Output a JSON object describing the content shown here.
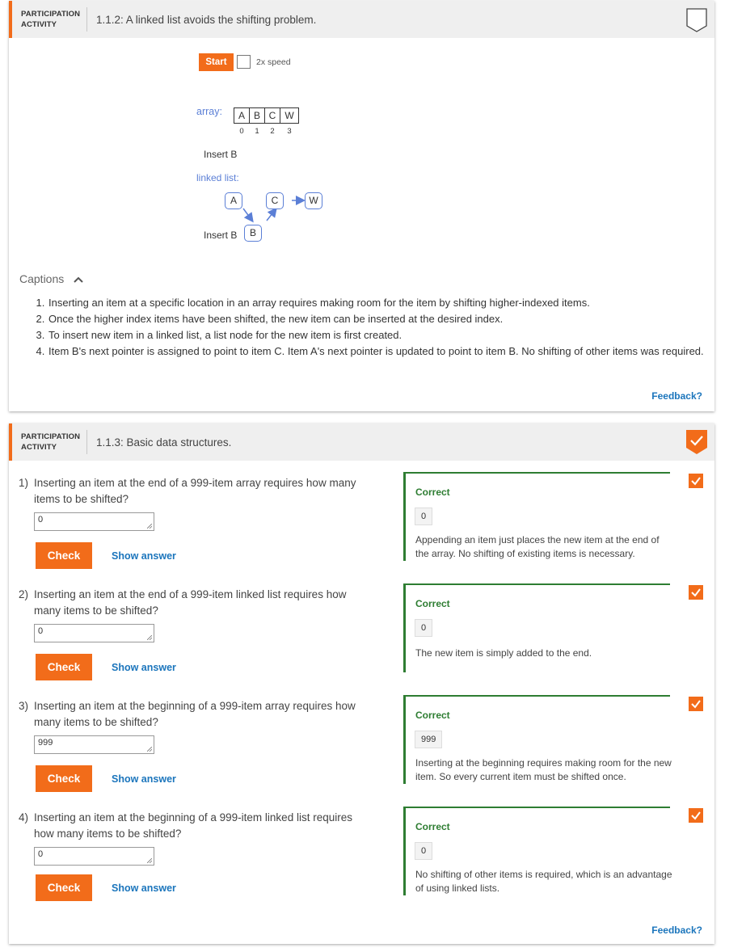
{
  "activity1": {
    "label_line1": "PARTICIPATION",
    "label_line2": "ACTIVITY",
    "title": "1.1.2: A linked list avoids the shifting problem.",
    "start_label": "Start",
    "speed_label": "2x speed",
    "array_label": "array:",
    "array_cells": [
      "A",
      "B",
      "C",
      "W"
    ],
    "array_indices": [
      "0",
      "1",
      "2",
      "3"
    ],
    "insert_text": "Insert B",
    "linked_list_label": "linked list:",
    "nodes": {
      "a": "A",
      "c": "C",
      "w": "W",
      "b": "B"
    },
    "insert_text_2": "Insert B",
    "captions_toggle": "Captions",
    "captions": [
      "Inserting an item at a specific location in an array requires making room for the item by shifting higher-indexed items.",
      "Once the higher index items have been shifted, the new item can be inserted at the desired index.",
      "To insert new item in a linked list, a list node for the new item is first created.",
      "Item B's next pointer is assigned to point to item C. Item A's next pointer is updated to point to item B. No shifting of other items was required."
    ],
    "feedback": "Feedback?"
  },
  "activity2": {
    "label_line1": "PARTICIPATION",
    "label_line2": "ACTIVITY",
    "title": "1.1.3: Basic data structures.",
    "feedback": "Feedback?",
    "check_label": "Check",
    "show_answer_label": "Show answer",
    "correct_label": "Correct",
    "questions": [
      {
        "num": "1)",
        "line1": "Inserting an item at the end of a 999-item array requires how many",
        "line2": "items to be shifted?",
        "input": "0",
        "answer": "0",
        "explanation": "Appending an item just places the new item at the end of the array. No shifting of existing items is necessary."
      },
      {
        "num": "2)",
        "line1": "Inserting an item at the end of a 999-item linked list requires how",
        "line2": "many items to be shifted?",
        "input": "0",
        "answer": "0",
        "explanation": "The new item is simply added to the end."
      },
      {
        "num": "3)",
        "line1": "Inserting an item at the beginning of a 999-item array requires how",
        "line2": "many items to be shifted?",
        "input": "999",
        "answer": "999",
        "explanation": "Inserting at the beginning requires making room for the new item. So every current item must be shifted once."
      },
      {
        "num": "4)",
        "line1": "Inserting an item at the beginning of a 999-item linked list requires",
        "line2": "how many items to be shifted?",
        "input": "0",
        "answer": "0",
        "explanation": "No shifting of other items is required, which is an advantage of using linked lists."
      }
    ]
  },
  "colors": {
    "accent": "#f26c1a",
    "correct": "#2e7d32",
    "link": "#1b75bc",
    "diagram_blue": "#5b7fd6"
  },
  "icons": {
    "activity1_badge": "bookmark-outline-icon",
    "activity2_badge": "checkmark-badge-icon",
    "captions_toggle": "chevron-up-icon",
    "question_status": "check-icon"
  }
}
